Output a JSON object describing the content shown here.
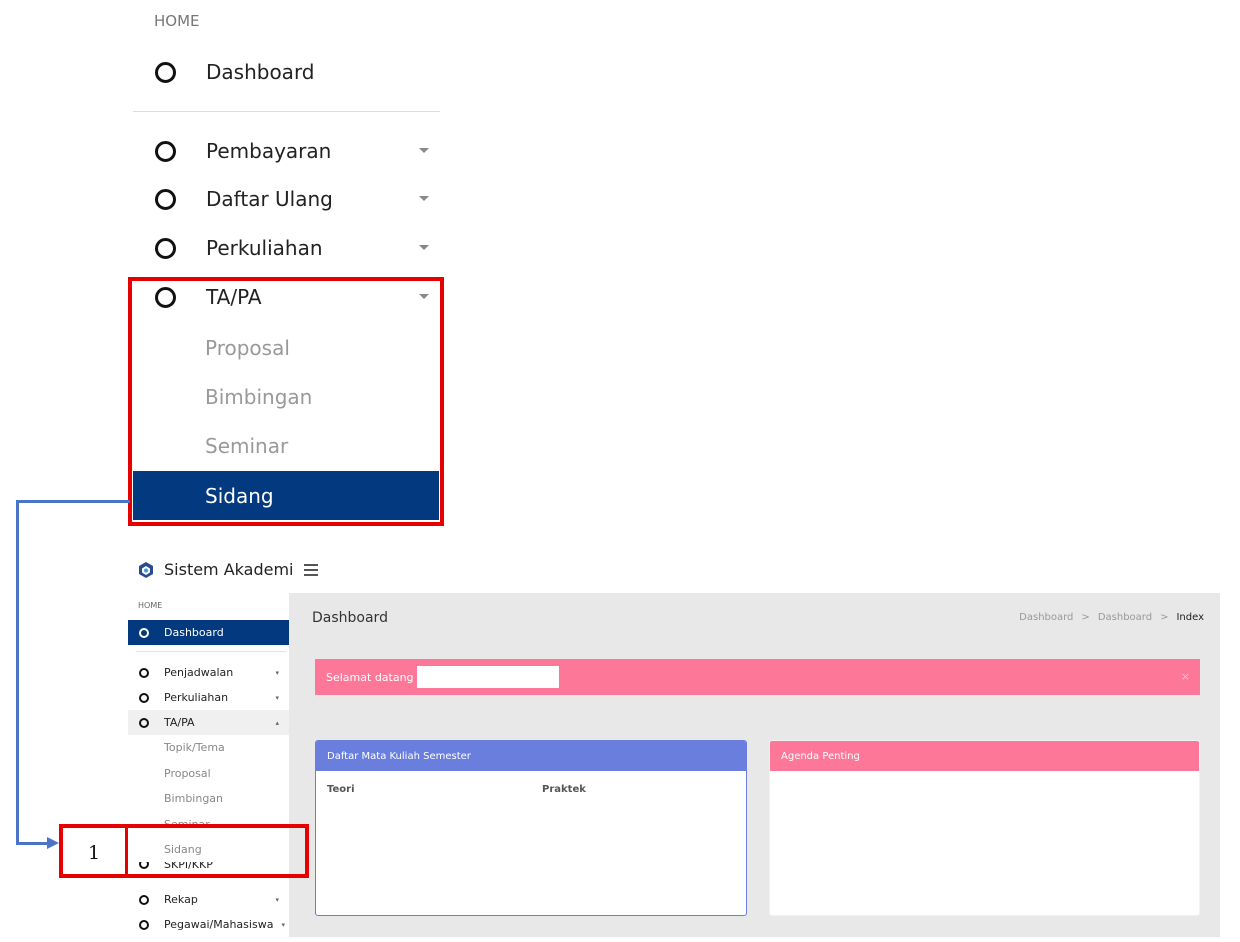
{
  "zoom": {
    "home_label": "HOME",
    "dashboard_label": "Dashboard",
    "items": [
      {
        "label": "Pembayaran"
      },
      {
        "label": "Daftar Ulang"
      },
      {
        "label": "Perkuliahan"
      },
      {
        "label": "TA/PA"
      }
    ],
    "submenu": [
      {
        "label": "Proposal"
      },
      {
        "label": "Bimbingan"
      },
      {
        "label": "Seminar"
      },
      {
        "label": "Sidang",
        "active": true
      }
    ]
  },
  "annotation": {
    "number": "1",
    "highlight_color": "#e60000",
    "arrow_color": "#4a74c8"
  },
  "app": {
    "brand_title": "Sistem Akademik",
    "sidebar": {
      "home_label": "HOME",
      "dashboard_label": "Dashboard",
      "items": [
        {
          "label": "Penjadwalan"
        },
        {
          "label": "Perkuliahan"
        },
        {
          "label": "TA/PA"
        }
      ],
      "submenu": [
        {
          "label": "Topik/Tema"
        },
        {
          "label": "Proposal"
        },
        {
          "label": "Bimbingan"
        },
        {
          "label": "Seminar"
        },
        {
          "label": "Sidang"
        }
      ],
      "after_items": [
        {
          "label": "SKPI/KKP"
        },
        {
          "label": "Rekap"
        },
        {
          "label": "Pegawai/Mahasiswa"
        }
      ]
    },
    "page_title": "Dashboard",
    "breadcrumb": [
      "Dashboard",
      ">",
      "Dashboard",
      ">",
      "Index"
    ],
    "alert": {
      "text": "Selamat datang",
      "close": "×"
    },
    "card_courses": {
      "title": "Daftar Mata Kuliah Semester",
      "col_theory": "Teori",
      "col_practice": "Praktek"
    },
    "card_agenda": {
      "title": "Agenda Penting"
    }
  },
  "colors": {
    "accent": "#03397f",
    "alert": "#fd7799",
    "card_blue": "#6a7fdd"
  }
}
